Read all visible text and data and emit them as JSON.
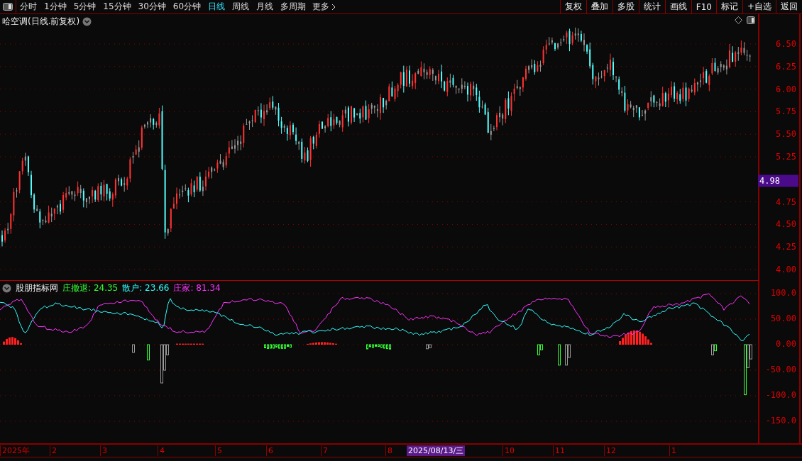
{
  "toolbar": {
    "tabs": [
      {
        "label": "分时",
        "selected": false
      },
      {
        "label": "1分钟",
        "selected": false
      },
      {
        "label": "5分钟",
        "selected": false
      },
      {
        "label": "15分钟",
        "selected": false
      },
      {
        "label": "30分钟",
        "selected": false
      },
      {
        "label": "60分钟",
        "selected": false
      },
      {
        "label": "日线",
        "selected": true
      },
      {
        "label": "周线",
        "selected": false
      },
      {
        "label": "月线",
        "selected": false
      },
      {
        "label": "多周期",
        "selected": false
      }
    ],
    "more": "更多",
    "buttons": [
      "复权",
      "叠加",
      "多股",
      "统计",
      "画线",
      "F10",
      "标记",
      "+自选",
      "返回"
    ]
  },
  "price_panel": {
    "title": "哈空调(日线.前复权)",
    "axis_ticks": [
      "6.50",
      "6.25",
      "6.00",
      "5.75",
      "5.50",
      "5.25",
      "4.75",
      "4.50",
      "4.25",
      "4.00"
    ],
    "current_price": "4.98"
  },
  "indicator_panel": {
    "name": "股朋指标网",
    "legend": [
      {
        "label": "庄撤退:",
        "value": "24.35",
        "color": "#33ff33"
      },
      {
        "label": "散户:",
        "value": "23.66",
        "color": "#33ffff"
      },
      {
        "label": "庄家:",
        "value": "81.34",
        "color": "#ff33ff"
      }
    ],
    "axis_ticks": [
      "100.0",
      "50.00",
      "0.00",
      "-50.00",
      "-100.0",
      "-150.0"
    ]
  },
  "date_axis": {
    "labels": [
      {
        "text": "2025年",
        "kind": "month"
      },
      {
        "text": "2",
        "kind": "month"
      },
      {
        "text": "3",
        "kind": "month"
      },
      {
        "text": "4",
        "kind": "month"
      },
      {
        "text": "5",
        "kind": "month"
      },
      {
        "text": "6",
        "kind": "month"
      },
      {
        "text": "7",
        "kind": "month"
      },
      {
        "text": "8",
        "kind": "month"
      },
      {
        "text": "2025/08/13/三",
        "kind": "cursor"
      },
      {
        "text": "10",
        "kind": "month"
      },
      {
        "text": "11",
        "kind": "month"
      },
      {
        "text": "12",
        "kind": "month"
      },
      {
        "text": "1",
        "kind": "month"
      }
    ]
  }
}
